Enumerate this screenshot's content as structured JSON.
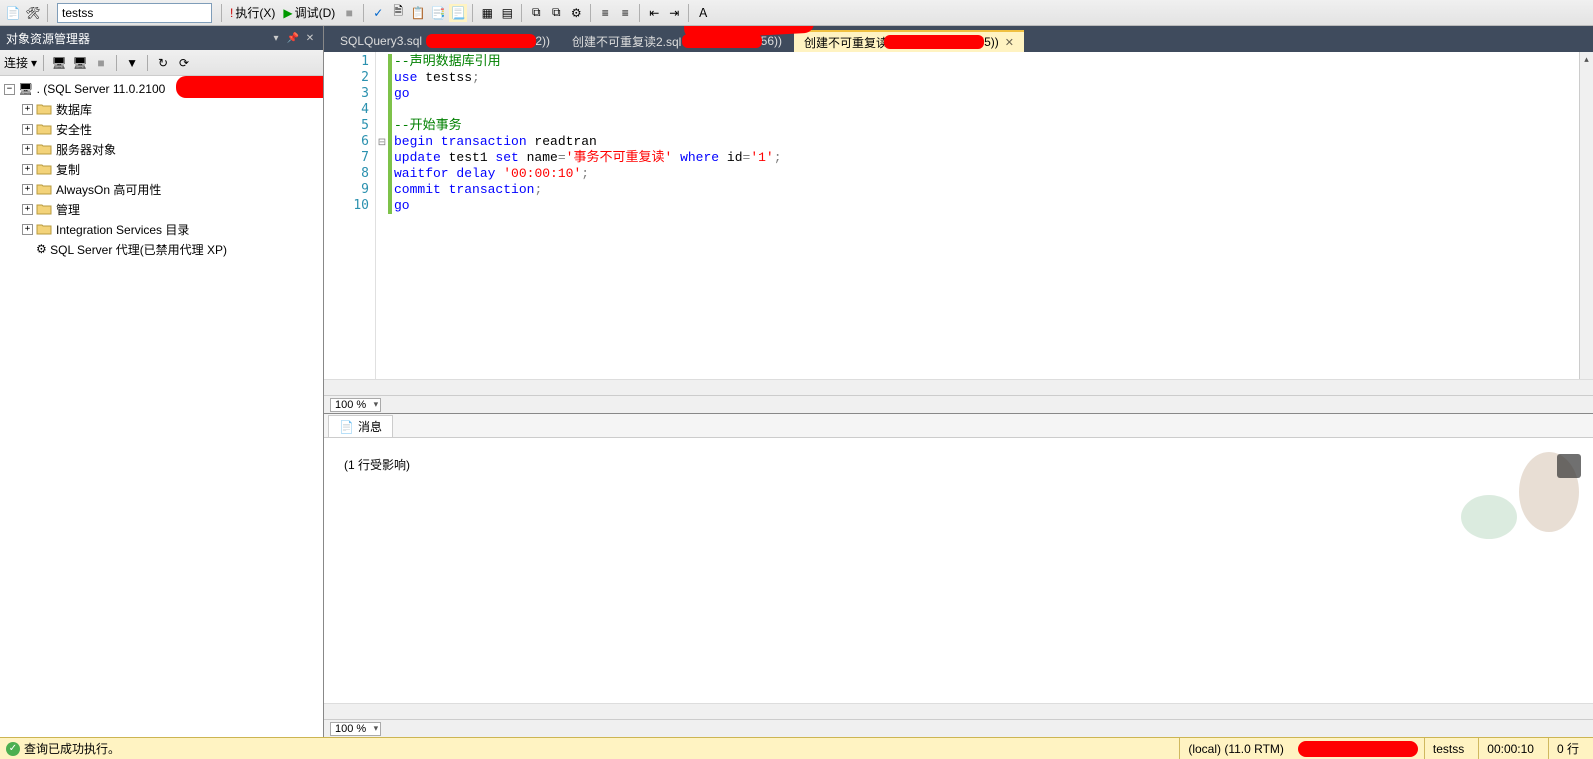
{
  "toolbar": {
    "db_value": "testss",
    "execute_label": "执行(X)",
    "debug_label": "调试(D)"
  },
  "explorer": {
    "title": "对象资源管理器",
    "connect_label": "连接",
    "server_label": ". (SQL Server 11.0.2100",
    "nodes": [
      {
        "label": "数据库",
        "icon": "folder"
      },
      {
        "label": "安全性",
        "icon": "folder"
      },
      {
        "label": "服务器对象",
        "icon": "folder"
      },
      {
        "label": "复制",
        "icon": "folder"
      },
      {
        "label": "AlwaysOn 高可用性",
        "icon": "folder"
      },
      {
        "label": "管理",
        "icon": "folder"
      },
      {
        "label": "Integration Services 目录",
        "icon": "folder"
      }
    ],
    "agent_label": "SQL Server 代理(已禁用代理 XP)"
  },
  "tabs": [
    {
      "label_prefix": "SQLQuery3.sql",
      "suffix": "2))",
      "active": false
    },
    {
      "label_prefix": "创建不可重复读2.sql",
      "suffix": "56))",
      "active": false
    },
    {
      "label_prefix": "创建不可重复读",
      "suffix": "55))",
      "active": true
    }
  ],
  "code": {
    "lines": [
      {
        "n": 1,
        "html": "<span class='c-comment'>--声明数据库引用</span>"
      },
      {
        "n": 2,
        "html": "<span class='c-keyword'>use</span> testss<span class='c-gray'>;</span>"
      },
      {
        "n": 3,
        "html": "<span class='c-keyword'>go</span>"
      },
      {
        "n": 4,
        "html": ""
      },
      {
        "n": 5,
        "html": "<span class='c-comment'>--开始事务</span>"
      },
      {
        "n": 6,
        "html": "<span class='c-keyword'>begin transaction</span> readtran"
      },
      {
        "n": 7,
        "html": "<span class='c-keyword'>update</span> test1 <span class='c-keyword'>set</span> name<span class='c-gray'>=</span><span class='c-string'>'事务不可重复读'</span> <span class='c-keyword'>where</span> id<span class='c-gray'>=</span><span class='c-string'>'1'</span><span class='c-gray'>;</span>"
      },
      {
        "n": 8,
        "html": "<span class='c-keyword'>waitfor delay</span> <span class='c-string'>'00:00:10'</span><span class='c-gray'>;</span>"
      },
      {
        "n": 9,
        "html": "<span class='c-keyword'>commit transaction</span><span class='c-gray'>;</span>"
      },
      {
        "n": 10,
        "html": "<span class='c-keyword'>go</span>"
      }
    ]
  },
  "zoom": {
    "value": "100 %"
  },
  "messages": {
    "tab_label": "消息",
    "text": "(1 行受影响)"
  },
  "statusbar": {
    "status_text": "查询已成功执行。",
    "server": "(local) (11.0 RTM)",
    "db": "testss",
    "elapsed": "00:00:10",
    "rows": "0 行"
  }
}
